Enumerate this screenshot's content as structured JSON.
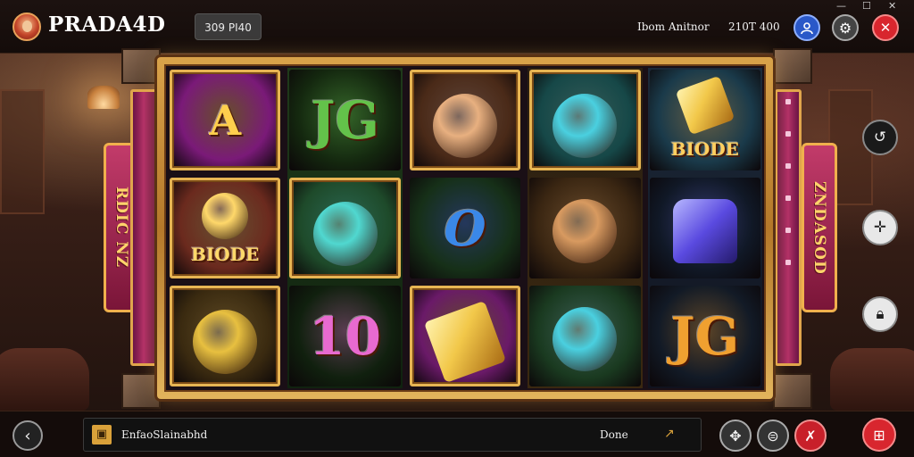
{
  "header": {
    "brand": "PRADA4D",
    "balance_pill": "309 PI40",
    "label_left": "Ibom Anitnor",
    "label_right": "210T 400"
  },
  "reels": [
    [
      {
        "text": "A",
        "kind": "letter-a",
        "bg": "#7a1a78",
        "color": "#ffcf4d"
      },
      {
        "text": "BIODE",
        "kind": "beast-label",
        "bg": "#6b2a1e",
        "color": "#ffd86a"
      },
      {
        "text": "",
        "kind": "lion",
        "bg": "#3a2a10",
        "color": "#e8c040"
      }
    ],
    [
      {
        "text": "JG",
        "kind": "jg-green",
        "bg": "#14280f",
        "color": "#63c24a"
      },
      {
        "text": "",
        "kind": "gangster",
        "bg": "#1e4a2a",
        "color": "#50d8d0"
      },
      {
        "text": "10",
        "kind": "ten",
        "bg": "#10200e",
        "color": "#e86ad0"
      }
    ],
    [
      {
        "text": "",
        "kind": "wolf",
        "bg": "#4a2a18",
        "color": "#e8b080"
      },
      {
        "text": "O",
        "kind": "o-badge",
        "bg": "#163018",
        "color": "#3a88e8"
      },
      {
        "text": "",
        "kind": "goldbar-purple",
        "bg": "#6a1a68",
        "color": "#f2c84a"
      }
    ],
    [
      {
        "text": "",
        "kind": "croc",
        "bg": "#164848",
        "color": "#4ad0e0"
      },
      {
        "text": "",
        "kind": "cat",
        "bg": "#3a2612",
        "color": "#d89a60"
      },
      {
        "text": "",
        "kind": "croc2",
        "bg": "#1a3a20",
        "color": "#4ad0e0"
      }
    ],
    [
      {
        "text": "BIODE",
        "kind": "goldbar-label",
        "bg": "#1a3a4a",
        "color": "#ffd060"
      },
      {
        "text": "",
        "kind": "chair",
        "bg": "#101826",
        "color": "#6a6ae8"
      },
      {
        "text": "JG",
        "kind": "jg-gold",
        "bg": "#121a26",
        "color": "#f0a030"
      }
    ]
  ],
  "banners": {
    "left": "RDIC NZ",
    "right": "ZNDASOD"
  },
  "footer": {
    "message": "EnfaoSlainabhd",
    "done_label": "Done"
  }
}
